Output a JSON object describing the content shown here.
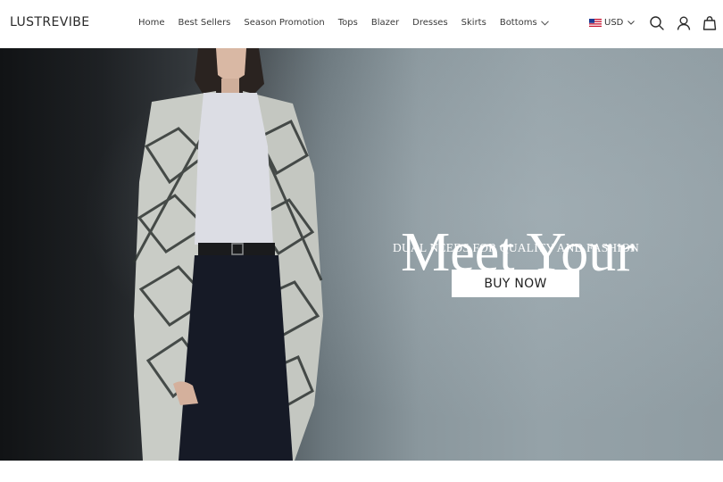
{
  "brand": {
    "name": "LUSTREVIBE"
  },
  "nav": {
    "items": [
      "Home",
      "Best Sellers",
      "Season Promotion",
      "Tops",
      "Blazer",
      "Dresses",
      "Skirts",
      "Bottoms"
    ]
  },
  "currency": {
    "label": "USD",
    "flag_icon": "us-flag-icon"
  },
  "header_icons": [
    "search-icon",
    "account-icon",
    "cart-bag-icon"
  ],
  "hero": {
    "headline": "Meet Your",
    "subline": "DUAL NEEDS FOR QUALITY AND FASHION",
    "cta_label": "BUY NOW"
  },
  "colors": {
    "header_bg": "#ffffff",
    "hero_bg_dark": "#1e2124",
    "hero_bg_light": "#95a2a8",
    "text_white": "#ffffff",
    "text_dark": "#222222"
  }
}
